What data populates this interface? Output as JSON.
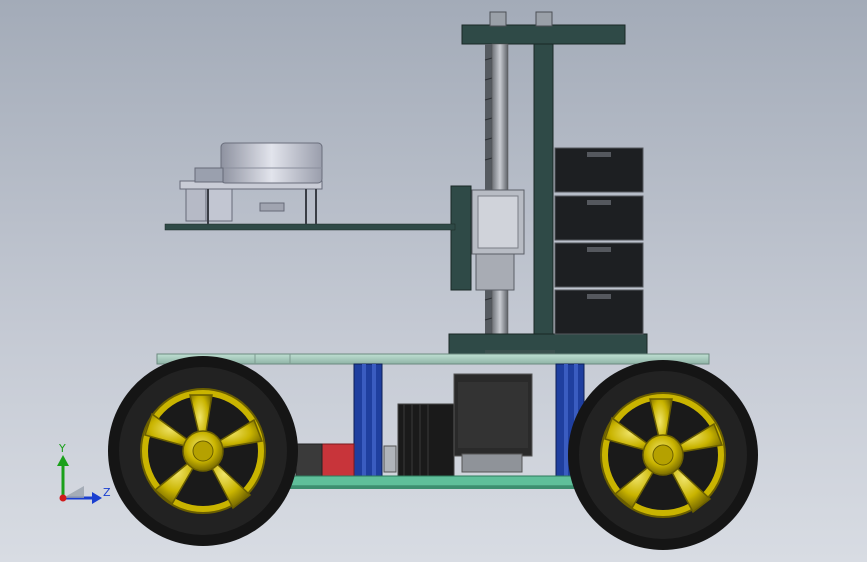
{
  "triad": {
    "y_label": "Y",
    "z_label": "Z",
    "y_color": "#1aa01a",
    "z_color": "#1a3fd0",
    "x_color": "#d01a1a"
  },
  "colors": {
    "frame": "#2f4a47",
    "plate": "#a9c9bd",
    "board": "#5fbf9a",
    "profile": "#1f3f9f",
    "tire": "#151515",
    "rim": "#c9b400",
    "hub": "#b5a100",
    "drawer": "#1d1f22",
    "lidar": "#c6c9d6",
    "motor": "#2a2a2a",
    "battery": "#c8343a"
  }
}
